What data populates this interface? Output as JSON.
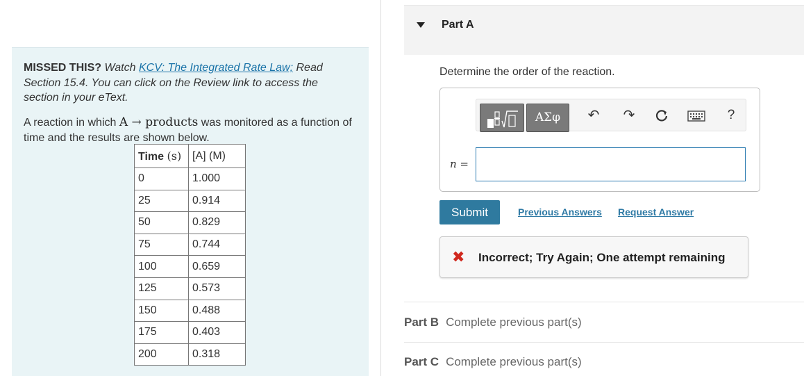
{
  "left": {
    "missed_label": "MISSED THIS?",
    "watch_text": "Watch",
    "watch_link": "KCV: The Integrated Rate Law;",
    "read_text": "Read Section 15.4. You can click on the Review link to access the section in your eText.",
    "prompt_before": "A reaction in which",
    "prompt_reaction": "A → products",
    "prompt_after": "was monitored as a function of time and the results are shown below.",
    "table": {
      "header_time_label": "Time",
      "header_time_unit": "(s)",
      "header_conc": "[A] (M)",
      "rows": [
        [
          "0",
          "1.000"
        ],
        [
          "25",
          "0.914"
        ],
        [
          "50",
          "0.829"
        ],
        [
          "75",
          "0.744"
        ],
        [
          "100",
          "0.659"
        ],
        [
          "125",
          "0.573"
        ],
        [
          "150",
          "0.488"
        ],
        [
          "175",
          "0.403"
        ],
        [
          "200",
          "0.318"
        ]
      ]
    }
  },
  "partA": {
    "title": "Part A",
    "question": "Determine the order of the reaction.",
    "toolbar": {
      "symbols_label": "ΑΣφ",
      "help_label": "?"
    },
    "variable_label": "n =",
    "input_value": "",
    "submit_label": "Submit",
    "previous_answers_label": "Previous Answers",
    "request_answer_label": "Request Answer",
    "feedback": "Incorrect; Try Again; One attempt remaining"
  },
  "partB": {
    "title": "Part B",
    "status": "Complete previous part(s)"
  },
  "partC": {
    "title": "Part C",
    "status": "Complete previous part(s)"
  },
  "colors": {
    "accent": "#2f7a9f",
    "error": "#d0281e",
    "panel_bg": "#e9f4f6"
  }
}
